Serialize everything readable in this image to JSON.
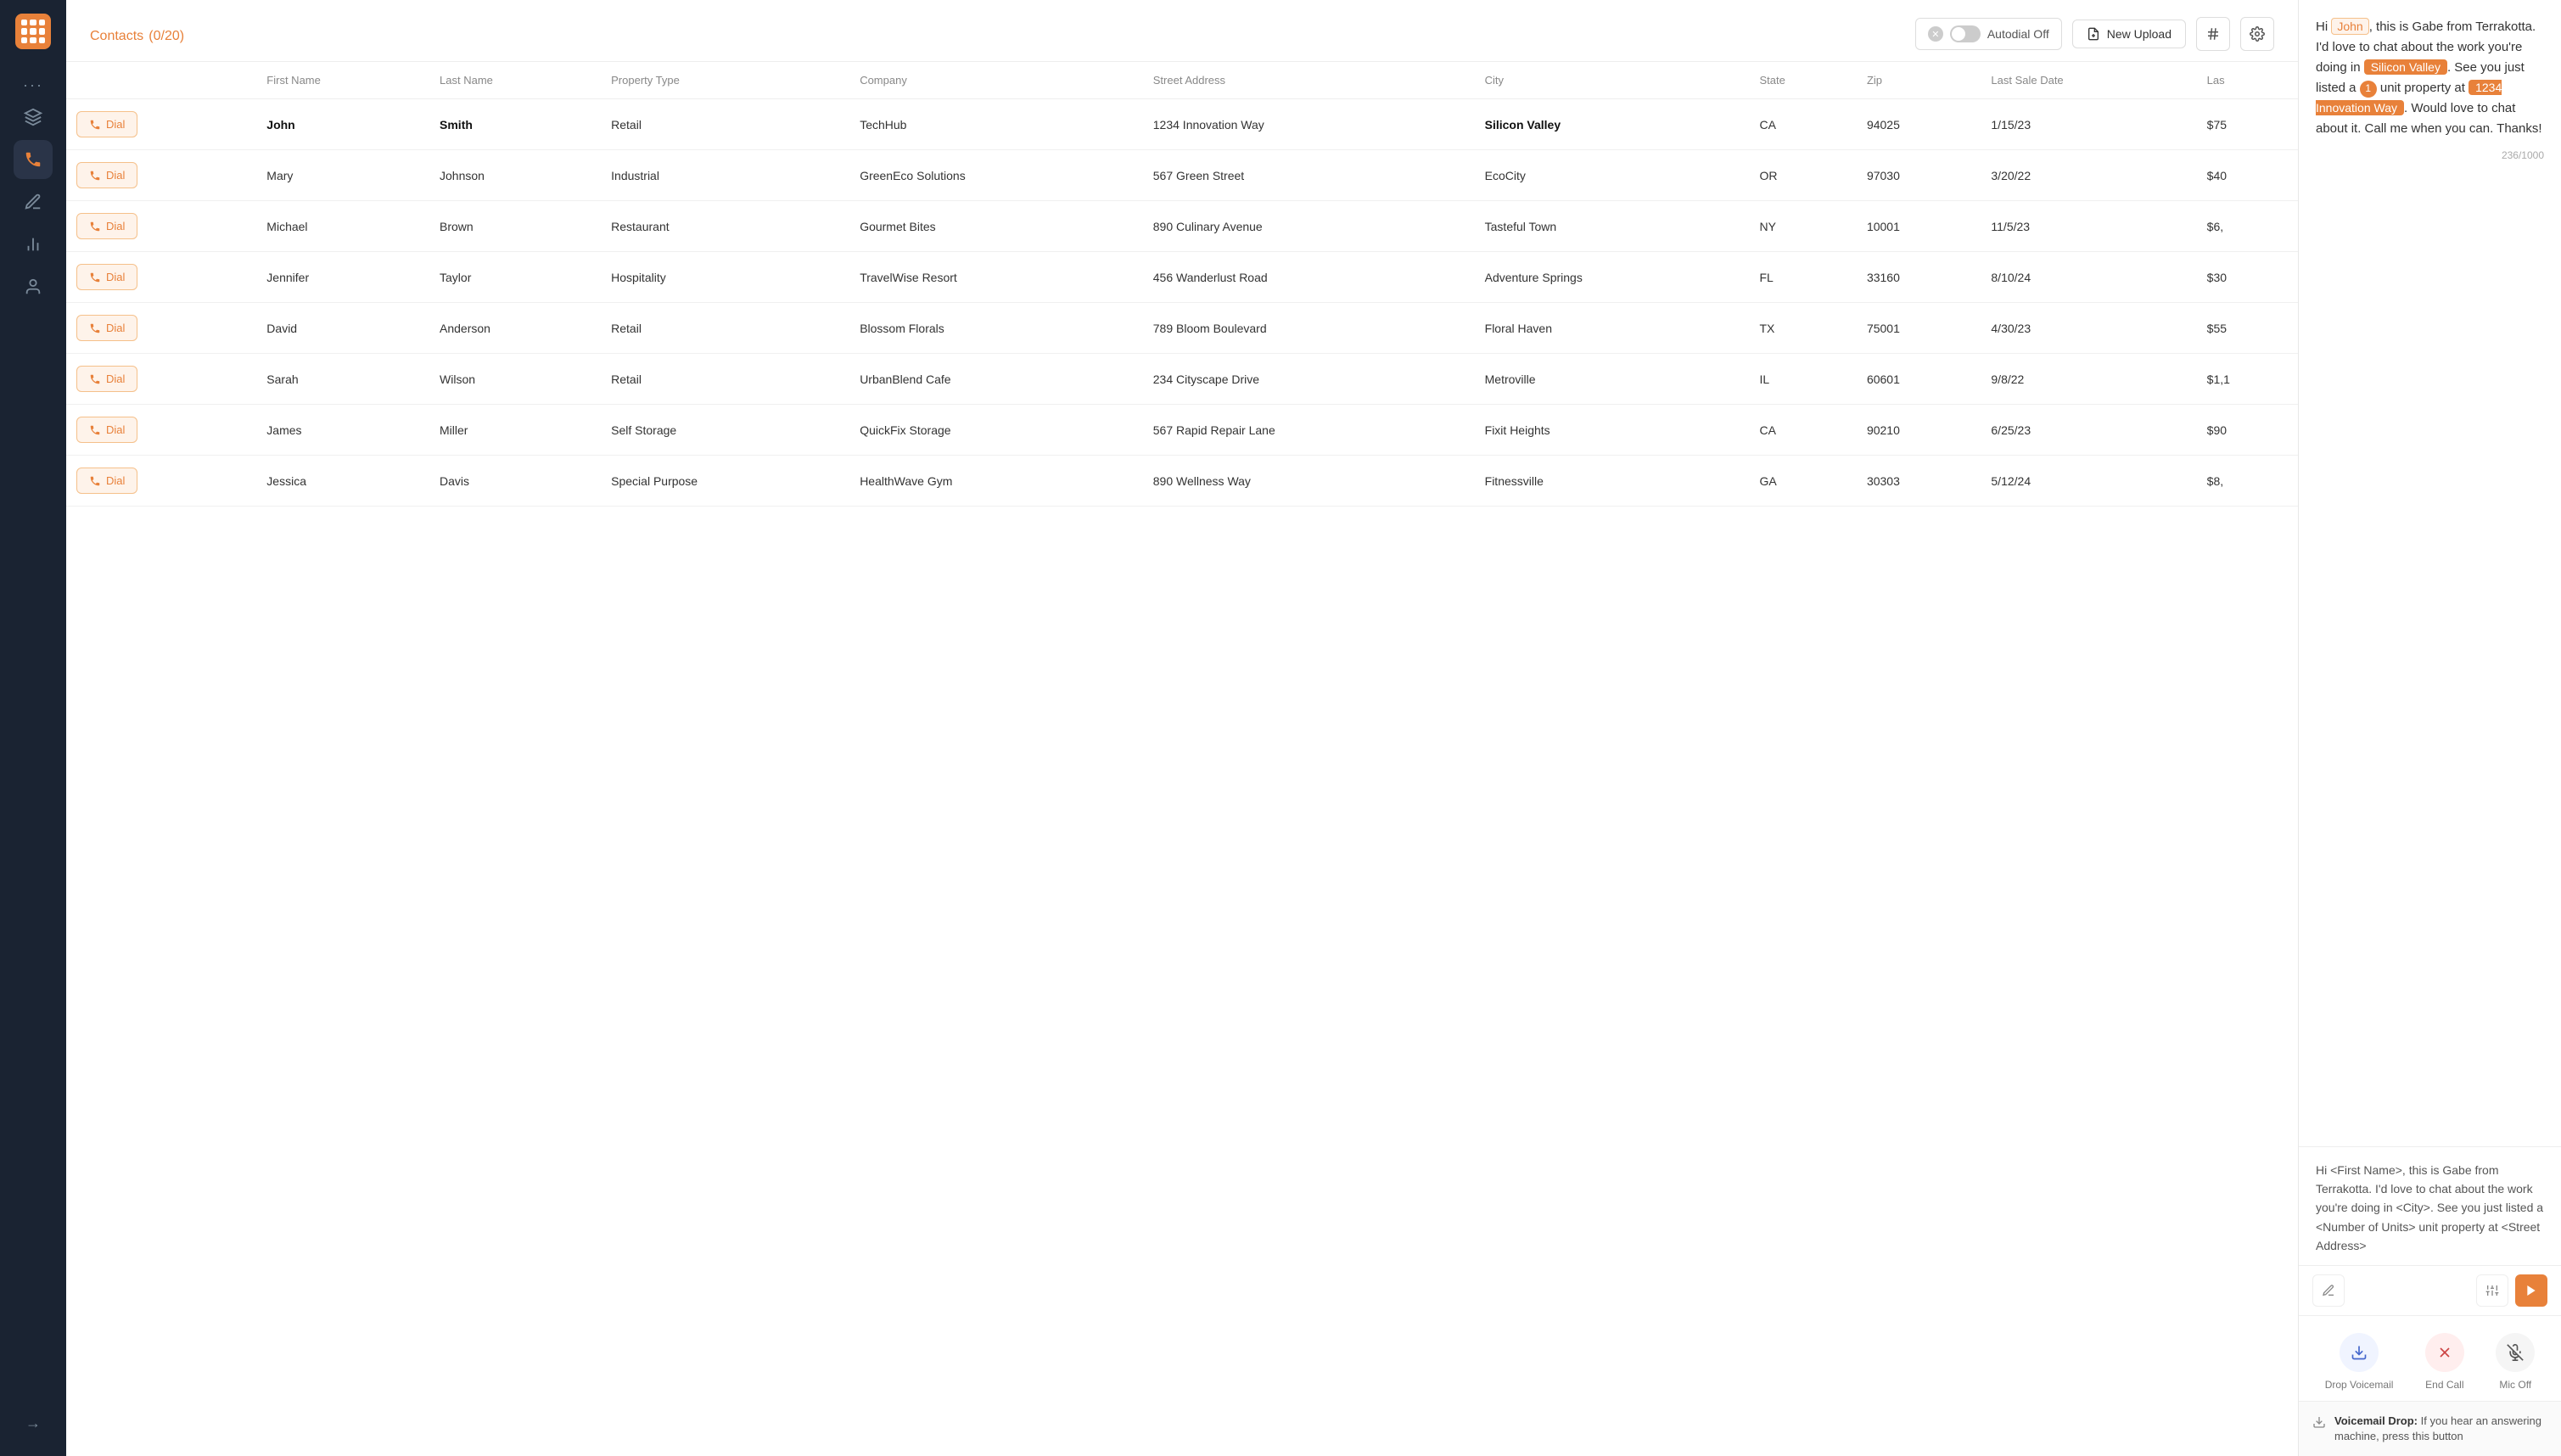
{
  "app": {
    "title": "Contacts",
    "count": "0/20"
  },
  "header": {
    "autodial_label": "Autodial Off",
    "upload_label": "New Upload"
  },
  "table": {
    "columns": [
      "",
      "First Name",
      "Last Name",
      "Property Type",
      "Company",
      "Street Address",
      "City",
      "State",
      "Zip",
      "Last Sale Date",
      "Las"
    ],
    "rows": [
      {
        "first": "John",
        "last": "Smith",
        "type": "Retail",
        "company": "TechHub",
        "address": "1234 Innovation Way",
        "city": "Silicon Valley",
        "state": "CA",
        "zip": "94025",
        "sale_date": "1/15/23",
        "amount": "$75"
      },
      {
        "first": "Mary",
        "last": "Johnson",
        "type": "Industrial",
        "company": "GreenEco Solutions",
        "address": "567 Green Street",
        "city": "EcoCity",
        "state": "OR",
        "zip": "97030",
        "sale_date": "3/20/22",
        "amount": "$40"
      },
      {
        "first": "Michael",
        "last": "Brown",
        "type": "Restaurant",
        "company": "Gourmet Bites",
        "address": "890 Culinary Avenue",
        "city": "Tasteful Town",
        "state": "NY",
        "zip": "10001",
        "sale_date": "11/5/23",
        "amount": "$6,"
      },
      {
        "first": "Jennifer",
        "last": "Taylor",
        "type": "Hospitality",
        "company": "TravelWise Resort",
        "address": "456 Wanderlust Road",
        "city": "Adventure Springs",
        "state": "FL",
        "zip": "33160",
        "sale_date": "8/10/24",
        "amount": "$30"
      },
      {
        "first": "David",
        "last": "Anderson",
        "type": "Retail",
        "company": "Blossom Florals",
        "address": "789 Bloom Boulevard",
        "city": "Floral Haven",
        "state": "TX",
        "zip": "75001",
        "sale_date": "4/30/23",
        "amount": "$55"
      },
      {
        "first": "Sarah",
        "last": "Wilson",
        "type": "Retail",
        "company": "UrbanBlend Cafe",
        "address": "234 Cityscape Drive",
        "city": "Metroville",
        "state": "IL",
        "zip": "60601",
        "sale_date": "9/8/22",
        "amount": "$1,1"
      },
      {
        "first": "James",
        "last": "Miller",
        "type": "Self Storage",
        "company": "QuickFix Storage",
        "address": "567 Rapid Repair Lane",
        "city": "Fixit Heights",
        "state": "CA",
        "zip": "90210",
        "sale_date": "6/25/23",
        "amount": "$90"
      },
      {
        "first": "Jessica",
        "last": "Davis",
        "type": "Special Purpose",
        "company": "HealthWave Gym",
        "address": "890 Wellness Way",
        "city": "Fitnessville",
        "state": "GA",
        "zip": "30303",
        "sale_date": "5/12/24",
        "amount": "$8,"
      }
    ],
    "dial_label": "Dial"
  },
  "message_preview": {
    "greeting": "Hi ",
    "name_highlight": "John",
    "text1": ", this is Gabe from Terrakotta. I'd love to chat about the work you're doing in ",
    "city_highlight": "Silicon Valley",
    "text2": ". See you just listed a ",
    "num_highlight": "1",
    "text3": " unit property at ",
    "addr_highlight": "1234 Innovation Way",
    "text4": ". Would love to chat about it. Call me when you can. Thanks!",
    "char_count": "236/1000"
  },
  "template_text": "Hi <First Name>, this is Gabe from Terrakotta. I'd love to chat about the work you're doing in <City>. See you just listed a <Number of Units> unit property at <Street Address>",
  "call_controls": {
    "drop_voicemail_label": "Drop Voicemail",
    "end_call_label": "End Call",
    "mic_off_label": "Mic Off"
  },
  "voicemail_drop": {
    "label": "Voicemail Drop:",
    "text": "If you hear an answering machine, press this button"
  }
}
